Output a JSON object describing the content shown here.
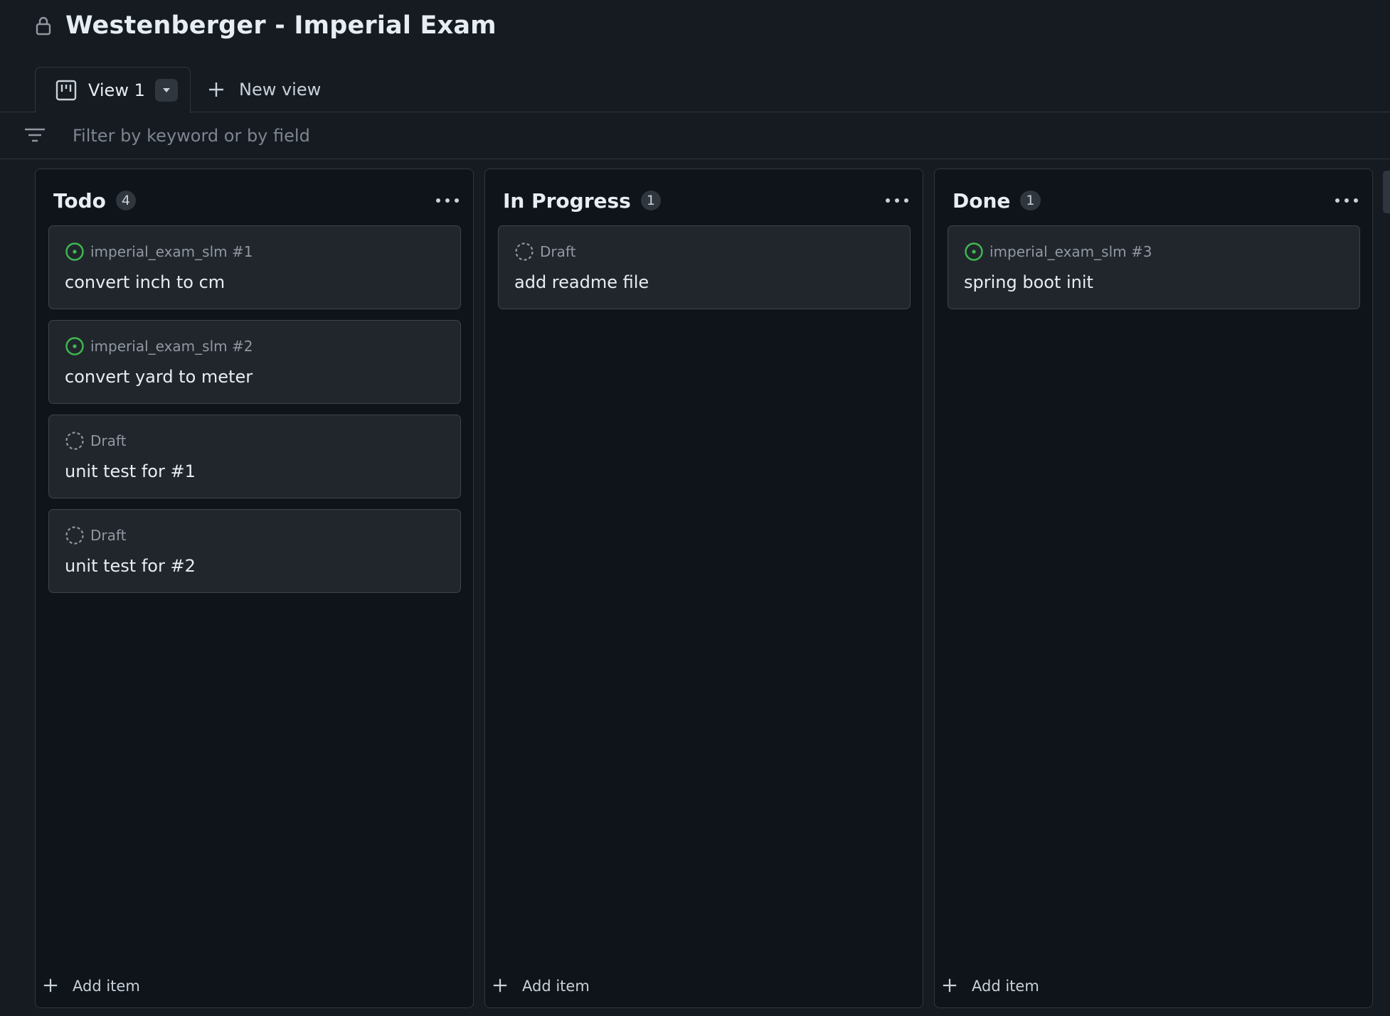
{
  "header": {
    "title": "Westenberger - Imperial Exam",
    "icon": "lock-icon"
  },
  "tabs": {
    "view_label": "View 1",
    "new_view_label": "New view"
  },
  "filter": {
    "placeholder": "Filter by keyword or by field"
  },
  "columns": [
    {
      "title": "Todo",
      "count": "4",
      "add_item_label": "Add item",
      "cards": [
        {
          "meta": "imperial_exam_slm #1",
          "title": "convert inch to cm",
          "status": "open-issue-icon"
        },
        {
          "meta": "imperial_exam_slm #2",
          "title": "convert yard to meter",
          "status": "open-issue-icon"
        },
        {
          "meta": "Draft",
          "title": "unit test for #1",
          "status": "draft-icon"
        },
        {
          "meta": "Draft",
          "title": "unit test for #2",
          "status": "draft-icon"
        }
      ]
    },
    {
      "title": "In Progress",
      "count": "1",
      "add_item_label": "Add item",
      "cards": [
        {
          "meta": "Draft",
          "title": "add readme file",
          "status": "draft-icon"
        }
      ]
    },
    {
      "title": "Done",
      "count": "1",
      "add_item_label": "Add item",
      "cards": [
        {
          "meta": "imperial_exam_slm #3",
          "title": "spring boot init",
          "status": "open-issue-icon"
        }
      ]
    }
  ],
  "colors": {
    "background": "#161b22",
    "column_background": "#0f141a",
    "card_background": "#21262d",
    "border": "#30363d",
    "open_issue_green": "#3fb950",
    "muted_text": "#9198a1"
  }
}
